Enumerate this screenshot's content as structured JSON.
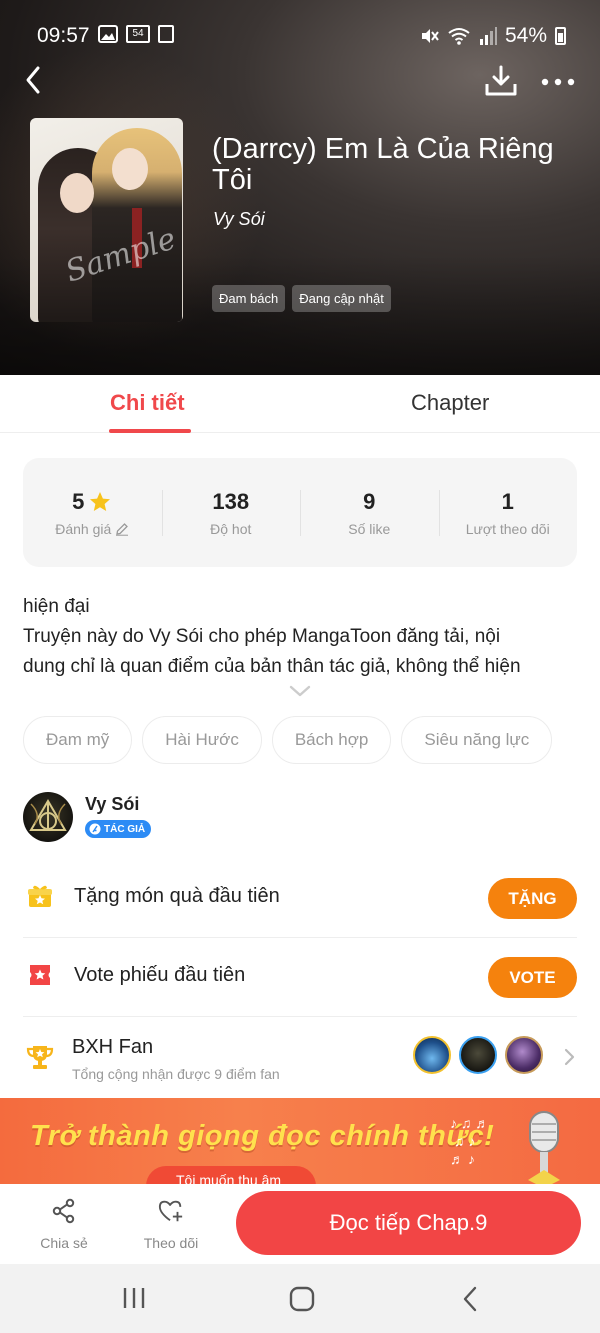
{
  "status_bar": {
    "time": "09:57",
    "battery": "54%",
    "notif_badge": "54"
  },
  "header": {
    "title": "(Darrcy) Em Là Của Riêng Tôi",
    "author": "Vy Sói",
    "tags": [
      "Đam bách",
      "Đang cập nhật"
    ],
    "cover_watermark": "Sample"
  },
  "tabs": {
    "details": "Chi tiết",
    "chapter": "Chapter"
  },
  "stats": [
    {
      "value": "5",
      "label": "Đánh giá"
    },
    {
      "value": "138",
      "label": "Độ hot"
    },
    {
      "value": "9",
      "label": "Số like"
    },
    {
      "value": "1",
      "label": "Lượt theo dõi"
    }
  ],
  "description": {
    "line1": "hiện đại",
    "line2": "Truyện này do Vy Sói cho phép MangaToon đăng tải, nội",
    "line3": "dung chỉ là quan điểm của bản thân tác giả, không thể hiện"
  },
  "genres": [
    "Đam mỹ",
    "Hài Hước",
    "Bách hợp",
    "Siêu năng lực"
  ],
  "author_section": {
    "name": "Vy Sói",
    "badge": "TÁC GIẢ"
  },
  "gift": {
    "text": "Tặng món quà đầu tiên",
    "button": "TẶNG"
  },
  "vote": {
    "text": "Vote phiếu đầu tiên",
    "button": "VOTE"
  },
  "fan_rank": {
    "title": "BXH Fan",
    "subtitle": "Tổng cộng nhận được 9 điểm fan"
  },
  "banner": {
    "title": "Trở thành giọng đọc chính thức!",
    "button": "Tôi muốn thu âm"
  },
  "bottom_bar": {
    "share": "Chia sẻ",
    "follow": "Theo dõi",
    "read": "Đọc tiếp Chap.9"
  },
  "colors": {
    "accent": "#f0484b",
    "orange": "#f5820d",
    "read_button": "#f24545",
    "badge_blue": "#2c8bf5"
  }
}
